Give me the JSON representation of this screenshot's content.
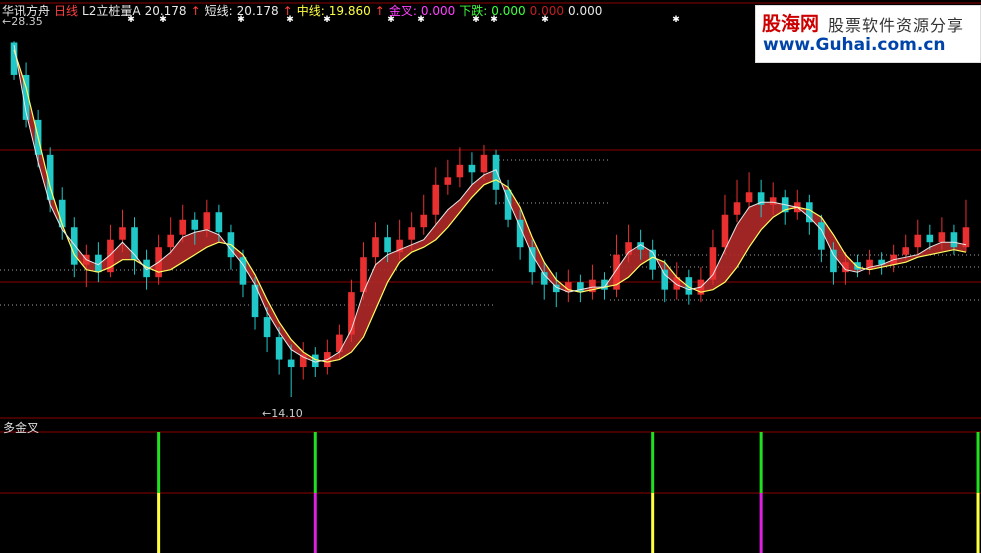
{
  "header": {
    "app_name": "华讯方舟",
    "period": "日线",
    "indicator_name": "L2立桩量A",
    "indicator_value": "20.178",
    "short_label": "短线:",
    "short_value": "20.178",
    "mid_label": "中线:",
    "mid_value": "19.860",
    "golden_label": "金叉:",
    "golden_value": "0.000",
    "down_label": "下跌:",
    "down_value": "0.000",
    "extra_value_1": "0.000",
    "extra_value_2": "0.000",
    "up_arrow": "↑"
  },
  "labels": {
    "max_price": "←28.35",
    "min_price": "←14.10",
    "sub_panel_title": "多金叉"
  },
  "logo": {
    "brand": "股海网",
    "tagline": "股票软件资源分享",
    "url": "www.Guhai.com.cn"
  },
  "colors": {
    "background": "#000000",
    "up_candle": "#e83030",
    "down_candle": "#20c8c8",
    "ribbon_fill": "#b02828",
    "short_line": "#e8e8e8",
    "mid_line": "#ffff60",
    "grid": "#8b0000",
    "dotted": "#a0a0a0",
    "signal_green": "#20e020",
    "signal_yellow": "#ffff40",
    "signal_magenta": "#e020e0"
  },
  "chart_data": {
    "type": "candlestick",
    "period": "daily",
    "price_max": 28.35,
    "price_min": 14.1,
    "ylim": [
      13.5,
      29.2
    ],
    "mid_line": [
      28.0,
      26.5,
      24.5,
      22.5,
      21.0,
      19.8,
      19.2,
      19.1,
      19.3,
      19.6,
      19.6,
      19.3,
      19.1,
      19.2,
      19.5,
      19.8,
      20.1,
      20.3,
      20.2,
      19.8,
      19.0,
      18.0,
      17.1,
      16.4,
      15.9,
      15.6,
      15.5,
      15.6,
      15.9,
      16.5,
      17.6,
      18.7,
      19.5,
      19.9,
      20.1,
      20.4,
      20.9,
      21.5,
      22.1,
      22.6,
      22.8,
      22.5,
      21.7,
      20.5,
      19.5,
      18.8,
      18.4,
      18.3,
      18.4,
      18.5,
      18.6,
      18.9,
      19.4,
      19.7,
      19.5,
      18.9,
      18.5,
      18.3,
      18.4,
      18.7,
      19.3,
      20.1,
      20.8,
      21.3,
      21.6,
      21.7,
      21.6,
      21.3,
      20.6,
      19.8,
      19.3,
      19.2,
      19.3,
      19.4,
      19.5,
      19.7,
      19.8,
      19.9,
      20.0,
      19.9
    ],
    "short_line": [
      28.2,
      25.5,
      23.5,
      21.8,
      20.8,
      20.2,
      19.6,
      19.4,
      19.8,
      20.3,
      19.8,
      19.2,
      19.5,
      19.9,
      20.5,
      20.7,
      20.8,
      20.6,
      20.0,
      19.4,
      18.6,
      17.5,
      16.7,
      16.0,
      15.7,
      15.5,
      15.6,
      15.9,
      16.8,
      18.3,
      19.4,
      19.8,
      20.0,
      20.2,
      20.4,
      21.0,
      21.6,
      22.0,
      22.6,
      23.0,
      23.2,
      22.0,
      20.9,
      19.8,
      19.0,
      18.5,
      18.3,
      18.4,
      18.5,
      18.5,
      19.2,
      19.9,
      20.2,
      19.9,
      19.0,
      18.6,
      18.4,
      18.5,
      19.0,
      20.0,
      21.0,
      21.7,
      21.9,
      21.9,
      21.8,
      21.7,
      21.3,
      20.8,
      19.8,
      19.2,
      19.1,
      19.3,
      19.4,
      19.6,
      19.7,
      19.8,
      20.1,
      20.3,
      20.3,
      20.2
    ],
    "candles": [
      [
        28.3,
        27.0,
        28.35,
        26.8
      ],
      [
        27.0,
        25.2,
        27.5,
        24.9
      ],
      [
        25.2,
        23.8,
        25.6,
        23.3
      ],
      [
        23.8,
        22.0,
        24.1,
        21.5
      ],
      [
        22.0,
        20.9,
        22.5,
        20.4
      ],
      [
        20.9,
        19.4,
        21.3,
        18.9
      ],
      [
        19.4,
        19.8,
        20.2,
        18.5
      ],
      [
        19.8,
        19.1,
        20.3,
        18.7
      ],
      [
        19.1,
        20.4,
        21.0,
        18.9
      ],
      [
        20.4,
        20.9,
        21.6,
        19.9
      ],
      [
        20.9,
        19.6,
        21.3,
        19.0
      ],
      [
        19.6,
        18.9,
        20.0,
        18.4
      ],
      [
        18.9,
        20.1,
        20.6,
        18.6
      ],
      [
        20.1,
        20.6,
        21.3,
        19.8
      ],
      [
        20.6,
        21.2,
        21.8,
        20.3
      ],
      [
        21.2,
        20.8,
        21.5,
        20.2
      ],
      [
        20.8,
        21.5,
        22.0,
        20.5
      ],
      [
        21.5,
        20.7,
        21.8,
        20.3
      ],
      [
        20.7,
        19.7,
        21.0,
        19.2
      ],
      [
        19.7,
        18.6,
        20.0,
        18.1
      ],
      [
        18.6,
        17.3,
        18.9,
        16.8
      ],
      [
        17.3,
        16.5,
        17.7,
        15.9
      ],
      [
        16.5,
        15.6,
        16.9,
        15.0
      ],
      [
        15.6,
        15.3,
        16.2,
        14.1
      ],
      [
        15.3,
        15.8,
        16.3,
        14.8
      ],
      [
        15.8,
        15.3,
        16.1,
        14.9
      ],
      [
        15.3,
        15.9,
        16.4,
        15.0
      ],
      [
        15.9,
        16.6,
        17.0,
        15.6
      ],
      [
        16.6,
        18.3,
        18.8,
        16.3
      ],
      [
        18.3,
        19.7,
        20.3,
        18.0
      ],
      [
        19.7,
        20.5,
        21.1,
        19.3
      ],
      [
        20.5,
        19.9,
        21.0,
        19.5
      ],
      [
        19.9,
        20.4,
        21.2,
        19.6
      ],
      [
        20.4,
        20.9,
        21.5,
        20.0
      ],
      [
        20.9,
        21.4,
        22.2,
        20.6
      ],
      [
        21.4,
        22.6,
        23.3,
        21.0
      ],
      [
        22.6,
        22.9,
        23.6,
        22.2
      ],
      [
        22.9,
        23.4,
        24.1,
        22.5
      ],
      [
        23.4,
        23.1,
        23.9,
        22.6
      ],
      [
        23.1,
        23.8,
        24.2,
        22.8
      ],
      [
        23.8,
        22.4,
        24.0,
        21.8
      ],
      [
        22.4,
        21.2,
        22.8,
        20.9
      ],
      [
        21.2,
        20.1,
        21.6,
        19.6
      ],
      [
        20.1,
        19.1,
        20.4,
        18.6
      ],
      [
        19.1,
        18.6,
        19.5,
        18.0
      ],
      [
        18.6,
        18.3,
        19.1,
        17.7
      ],
      [
        18.3,
        18.7,
        19.2,
        17.9
      ],
      [
        18.7,
        18.3,
        19.0,
        17.9
      ],
      [
        18.3,
        18.8,
        19.4,
        18.0
      ],
      [
        18.8,
        18.4,
        19.1,
        18.0
      ],
      [
        18.4,
        19.8,
        20.6,
        18.1
      ],
      [
        19.8,
        20.3,
        21.0,
        19.5
      ],
      [
        20.3,
        20.0,
        20.8,
        19.6
      ],
      [
        20.0,
        19.2,
        20.4,
        18.8
      ],
      [
        19.2,
        18.4,
        19.6,
        17.9
      ],
      [
        18.4,
        18.9,
        19.5,
        18.0
      ],
      [
        18.9,
        18.2,
        19.2,
        17.8
      ],
      [
        18.2,
        18.8,
        19.3,
        17.9
      ],
      [
        18.8,
        20.1,
        20.8,
        18.6
      ],
      [
        20.1,
        21.4,
        22.2,
        19.8
      ],
      [
        21.4,
        21.9,
        22.8,
        21.1
      ],
      [
        21.9,
        22.3,
        23.1,
        21.6
      ],
      [
        22.3,
        21.8,
        22.8,
        21.3
      ],
      [
        21.8,
        22.1,
        22.7,
        21.4
      ],
      [
        22.1,
        21.5,
        22.4,
        21.0
      ],
      [
        21.5,
        21.9,
        22.4,
        21.2
      ],
      [
        21.9,
        21.1,
        22.2,
        20.6
      ],
      [
        21.1,
        20.0,
        21.4,
        19.5
      ],
      [
        20.0,
        19.1,
        20.3,
        18.6
      ],
      [
        19.1,
        19.5,
        19.9,
        18.6
      ],
      [
        19.5,
        19.2,
        19.8,
        18.9
      ],
      [
        19.2,
        19.6,
        20.0,
        19.0
      ],
      [
        19.6,
        19.4,
        19.9,
        19.0
      ],
      [
        19.4,
        19.8,
        20.2,
        19.1
      ],
      [
        19.8,
        20.1,
        20.6,
        19.6
      ],
      [
        20.1,
        20.6,
        21.2,
        19.8
      ],
      [
        20.6,
        20.3,
        21.0,
        20.0
      ],
      [
        20.3,
        20.7,
        21.3,
        20.0
      ],
      [
        20.7,
        20.1,
        21.0,
        19.8
      ],
      [
        20.1,
        20.9,
        22.0,
        19.9
      ]
    ],
    "signal_bars": [
      12,
      25,
      53,
      62,
      80
    ]
  }
}
